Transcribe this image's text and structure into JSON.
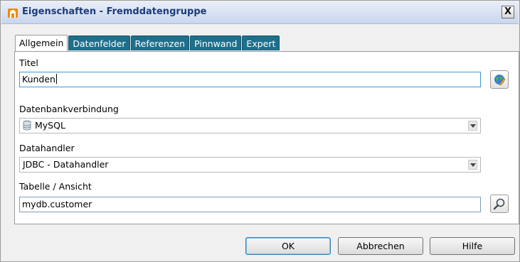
{
  "window": {
    "title": "Eigenschaften - Fremddatengruppe",
    "close_label": "X"
  },
  "tabs": [
    {
      "label": "Allgemein",
      "active": true
    },
    {
      "label": "Datenfelder",
      "active": false
    },
    {
      "label": "Referenzen",
      "active": false
    },
    {
      "label": "Pinnwand",
      "active": false
    },
    {
      "label": "Expert",
      "active": false
    }
  ],
  "form": {
    "title_label": "Titel",
    "title_value": "Kunden",
    "db_connection_label": "Datenbankverbindung",
    "db_connection_value": "MySQL",
    "datahandler_label": "Datahandler",
    "datahandler_value": "JDBC - Datahandler",
    "table_label": "Tabelle / Ansicht",
    "table_value": "mydb.customer"
  },
  "buttons": {
    "ok": "OK",
    "cancel": "Abbrechen",
    "help": "Hilfe"
  },
  "colors": {
    "tab_bg": "#1f6f8b",
    "title_text": "#1d3b78",
    "focus_border": "#3c9ad3"
  },
  "icons": {
    "title_icon": "app-house-icon",
    "title_side": "globe-edit-icon",
    "db_icon": "database-icon",
    "table_side": "magnifier-icon"
  }
}
